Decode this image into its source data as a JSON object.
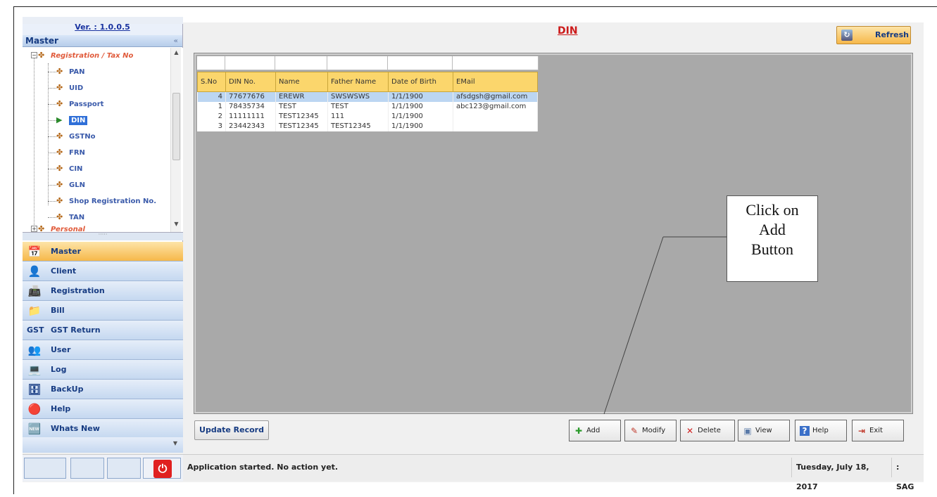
{
  "app": {
    "version_label": "Ver. : 1.0.0.5",
    "page_title": "DIN",
    "refresh_label": "Refresh"
  },
  "sidebar": {
    "header": "Master",
    "collapse_glyph": "«",
    "tree": [
      {
        "label": "Registration / Tax No",
        "type": "group"
      },
      {
        "label": "PAN"
      },
      {
        "label": "UID"
      },
      {
        "label": "Passport"
      },
      {
        "label": "DIN",
        "selected": true
      },
      {
        "label": "GSTNo"
      },
      {
        "label": "FRN"
      },
      {
        "label": "CIN"
      },
      {
        "label": "GLN"
      },
      {
        "label": "Shop Registration No."
      },
      {
        "label": "TAN"
      },
      {
        "label": "Personal",
        "type": "group"
      }
    ],
    "nav": [
      {
        "label": "Master",
        "icon": "calendar-icon",
        "active": true
      },
      {
        "label": "Client",
        "icon": "person-icon"
      },
      {
        "label": "Registration",
        "icon": "register-icon"
      },
      {
        "label": "Bill",
        "icon": "folder-icon"
      },
      {
        "label": "GST Return",
        "icon": "gst-icon"
      },
      {
        "label": "User",
        "icon": "users-icon"
      },
      {
        "label": "Log",
        "icon": "log-icon"
      },
      {
        "label": "BackUp",
        "icon": "backup-icon"
      },
      {
        "label": "Help",
        "icon": "help-icon"
      },
      {
        "label": "Whats New",
        "icon": "new-icon"
      }
    ]
  },
  "grid": {
    "columns": [
      "S.No",
      "DIN No.",
      "Name",
      "Father Name",
      "Date of Birth",
      "EMail"
    ],
    "rows": [
      [
        "4",
        "77677676",
        "EREWR",
        "SWSWSWS",
        "1/1/1900",
        "afsdgsh@gmail.com"
      ],
      [
        "1",
        "78435734",
        "TEST",
        "TEST",
        "1/1/1900",
        "abc123@gmail.com"
      ],
      [
        "2",
        "11111111",
        "TEST12345",
        "111",
        "1/1/1900",
        ""
      ],
      [
        "3",
        "23442343",
        "TEST12345",
        "TEST12345",
        "1/1/1900",
        ""
      ]
    ],
    "selected_row": 0
  },
  "callout": {
    "line1": "Click on",
    "line2": "Add",
    "line3": "Button"
  },
  "actions": {
    "update_record": "Update Record",
    "add": "Add",
    "modify": "Modify",
    "delete": "Delete",
    "view": "View",
    "help": "Help",
    "exit": "Exit"
  },
  "status": {
    "message": "Application started. No action yet.",
    "date": "Tuesday, July 18, 2017",
    "user": ": SAG"
  },
  "colors": {
    "accent_orange": "#f6b84a",
    "title_red": "#cc1a1a",
    "nav_blue": "#163b82",
    "grid_header": "#fbd66c",
    "selected_row": "#bcd6f2"
  }
}
